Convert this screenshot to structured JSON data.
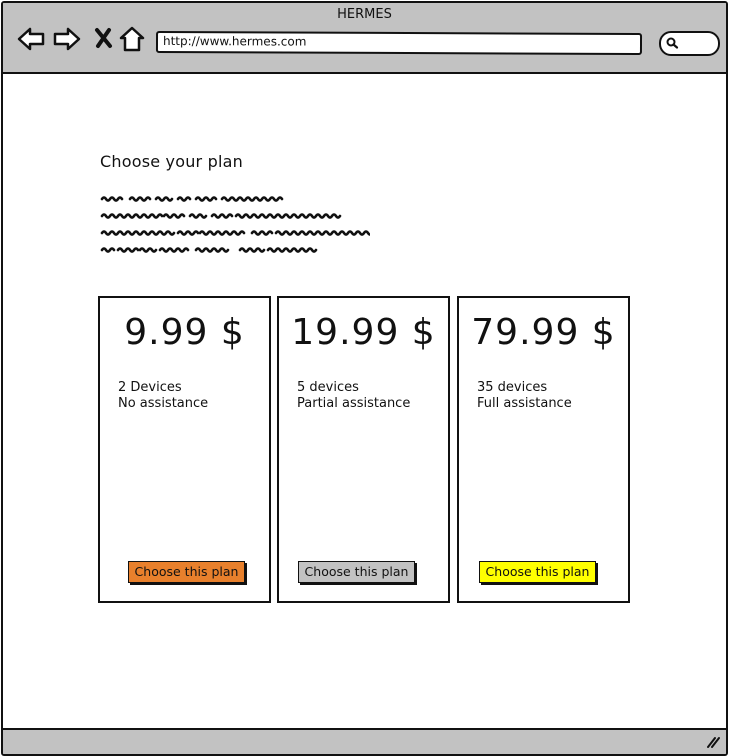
{
  "window": {
    "title": "HERMES"
  },
  "browser": {
    "url": "http://www.hermes.com",
    "nav_icons": [
      "back-arrow-icon",
      "forward-arrow-icon",
      "close-x-icon",
      "home-icon"
    ],
    "search_icon": "search-icon"
  },
  "main": {
    "heading": "Choose your plan"
  },
  "plans": [
    {
      "price": "9.99 $",
      "line1": "2 Devices",
      "line2": "No assistance",
      "button": "Choose this plan",
      "button_color": "#e8802c"
    },
    {
      "price": "19.99 $",
      "line1": "5 devices",
      "line2": "Partial assistance",
      "button": "Choose this plan",
      "button_color": "#c2c2c2"
    },
    {
      "price": "79.99 $",
      "line1": "35 devices",
      "line2": "Full assistance",
      "button": "Choose this plan",
      "button_color": "#ffff00"
    }
  ],
  "colors": {
    "chrome": "#c2c2c2",
    "border": "#111111"
  }
}
